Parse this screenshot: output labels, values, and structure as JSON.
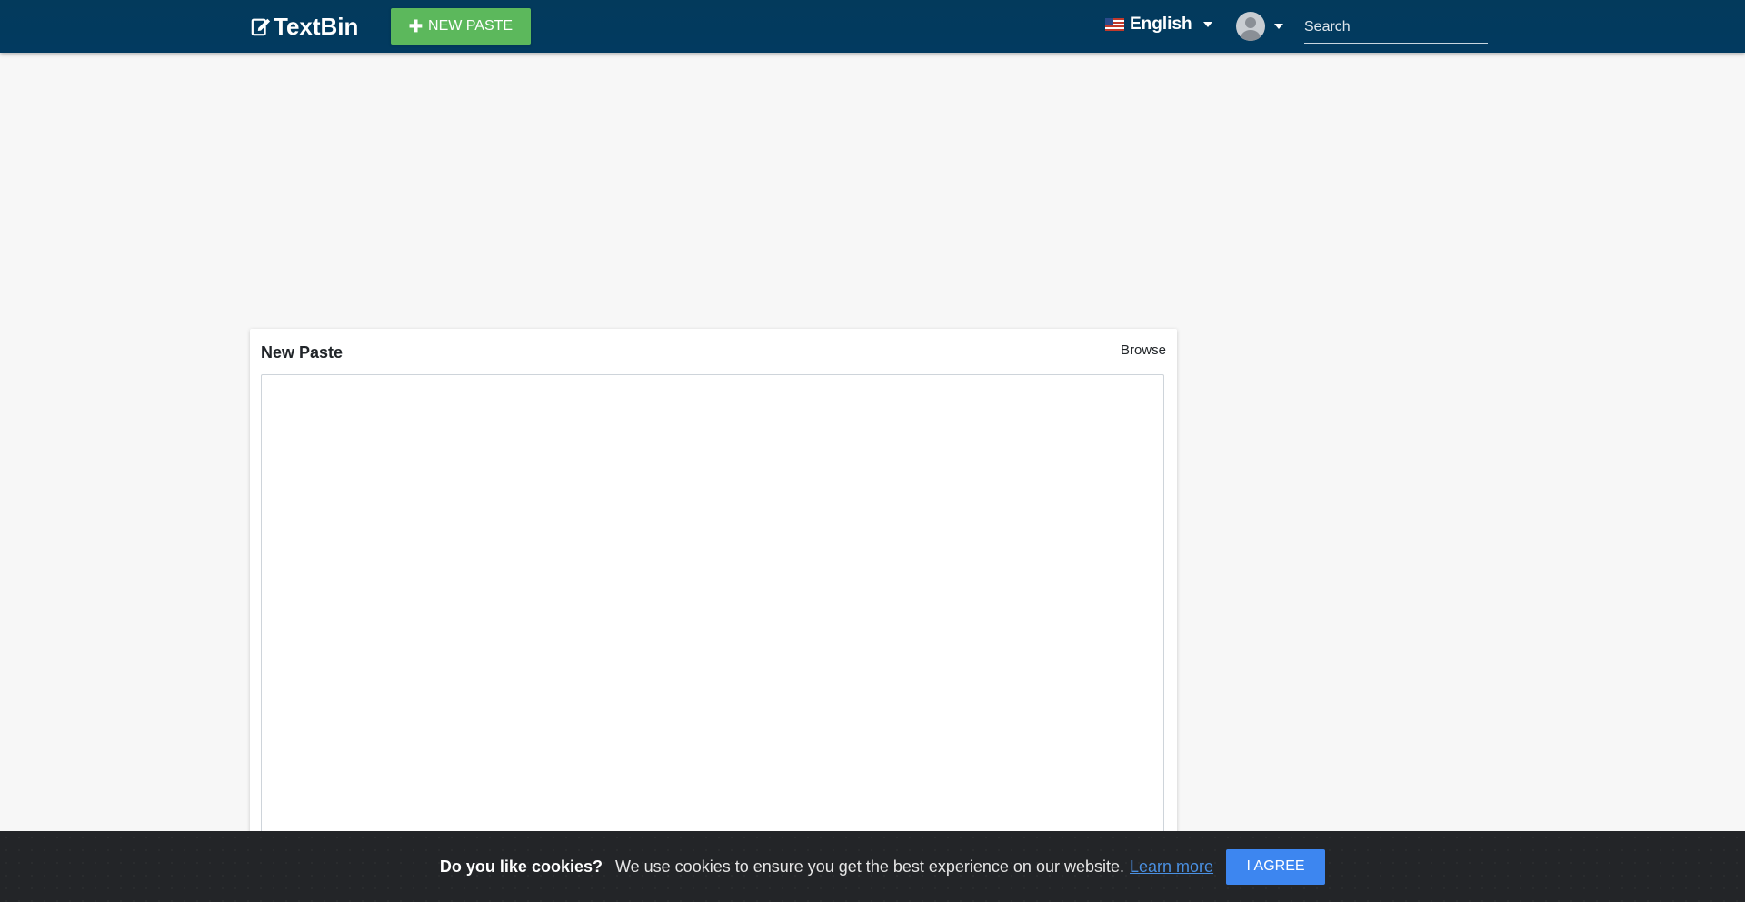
{
  "navbar": {
    "brand": "TextBin",
    "new_paste_label": "NEW PASTE",
    "language": "English",
    "search_placeholder": "Search"
  },
  "card": {
    "title": "New Paste",
    "browse_label": "Browse",
    "editor_value": ""
  },
  "cookie": {
    "question": "Do you like cookies?",
    "message": "We use cookies to ensure you get the best experience on our website.",
    "learn_more": "Learn more",
    "agree_label": "I AGREE"
  },
  "colors": {
    "navbar_bg": "#033a5c",
    "new_paste_green": "#5cb85c",
    "agree_blue": "#3d86f0",
    "cookie_bg": "#232528"
  },
  "icons": {
    "brand_icon": "edit-document-icon",
    "new_paste_icon": "plus-icon",
    "language_icon": "us-flag-icon",
    "user_icon": "avatar-icon",
    "dropdown_icon": "caret-down-icon"
  }
}
